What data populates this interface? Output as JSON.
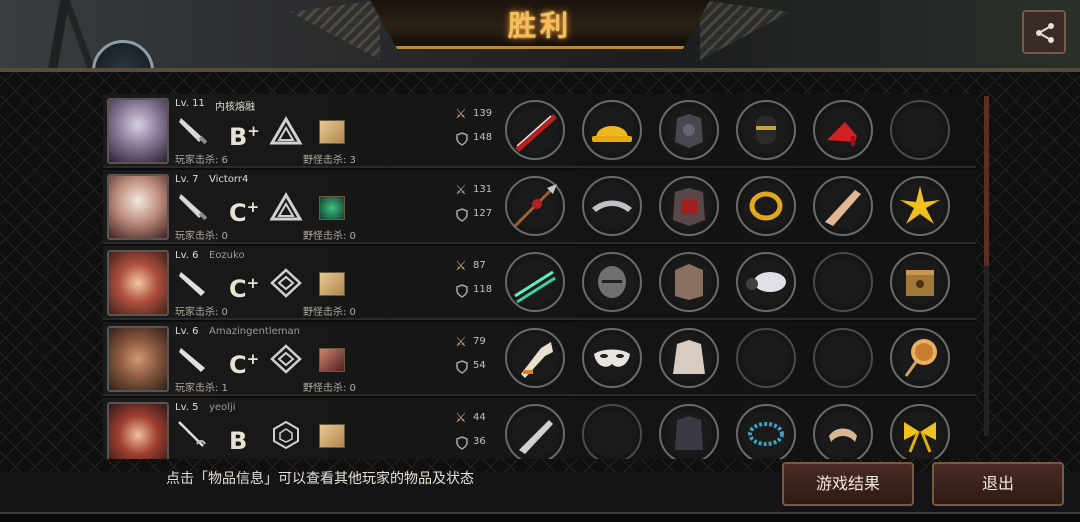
{
  "title": "胜利",
  "top": {
    "name": "内核熔融"
  },
  "hint": "点击「物品信息」可以查看其他玩家的物品及状态",
  "buttons": {
    "result": "游戏结果",
    "exit": "退出"
  },
  "labels": {
    "player_kills": "玩家击杀",
    "monster_kills": "野怪击杀"
  },
  "players": [
    {
      "level": "Lv. 11",
      "name": "内核熔融",
      "rank": "B",
      "rank_plus": "+",
      "player_kills": "玩家击杀: 6",
      "monster_kills": "野怪击杀: 3",
      "attack": "139",
      "defense": "148",
      "name_color": "#e0dcd0"
    },
    {
      "level": "Lv. 7",
      "name": "Victorr4",
      "rank": "C",
      "rank_plus": "+",
      "player_kills": "玩家击杀: 0",
      "monster_kills": "野怪击杀: 0",
      "attack": "131",
      "defense": "127",
      "name_color": "#e0dcd0"
    },
    {
      "level": "Lv. 6",
      "name": "Eozuko",
      "rank": "C",
      "rank_plus": "+",
      "player_kills": "玩家击杀: 0",
      "monster_kills": "野怪击杀: 0",
      "attack": "87",
      "defense": "118",
      "name_color": "#9a9a9a"
    },
    {
      "level": "Lv. 6",
      "name": "Amazingentleman",
      "rank": "C",
      "rank_plus": "+",
      "player_kills": "玩家击杀: 1",
      "monster_kills": "野怪击杀: 0",
      "attack": "79",
      "defense": "54",
      "name_color": "#9a9a9a"
    },
    {
      "level": "Lv. 5",
      "name": "yeolji",
      "rank": "B",
      "rank_plus": "",
      "player_kills": "",
      "monster_kills": "",
      "attack": "44",
      "defense": "36",
      "name_color": "#9a9a9a"
    }
  ],
  "colors": {
    "accent": "#f0c060",
    "button_bg": "#3a2420",
    "panel_bg": "#0f0f10"
  }
}
